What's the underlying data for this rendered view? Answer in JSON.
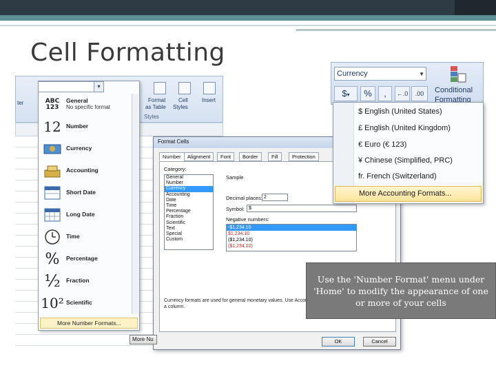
{
  "slide": {
    "title": "Cell Formatting",
    "callout": "Use the 'Number Format' menu under 'Home' to modify the appearance of one or more of your cells"
  },
  "ribbon": {
    "insert_label": "Insert",
    "format_as_table": "Format as Table",
    "cell_styles": "Cell Styles",
    "format_label": "Format",
    "cell_label": "Cell",
    "styles_group": "Styles",
    "ter_fragment": "ter",
    "as_table_fragment": "as Table",
    "styles_fragment": "Styles",
    "insert_fragment": "Insert"
  },
  "number_format_menu": {
    "items": [
      {
        "icon": "abc-123-icon",
        "glyph": "ABC 123",
        "label": "General",
        "sub": "No specific format"
      },
      {
        "icon": "number-12-icon",
        "glyph": "12",
        "label": "Number",
        "sub": ""
      },
      {
        "icon": "currency-icon",
        "glyph": "$",
        "label": "Currency",
        "sub": ""
      },
      {
        "icon": "accounting-icon",
        "glyph": "$",
        "label": "Accounting",
        "sub": ""
      },
      {
        "icon": "calendar-icon",
        "glyph": "",
        "label": "Short Date",
        "sub": ""
      },
      {
        "icon": "calendar-grid-icon",
        "glyph": "",
        "label": "Long Date",
        "sub": ""
      },
      {
        "icon": "clock-icon",
        "glyph": "",
        "label": "Time",
        "sub": ""
      },
      {
        "icon": "percent-icon",
        "glyph": "%",
        "label": "Percentage",
        "sub": ""
      },
      {
        "icon": "fraction-icon",
        "glyph": "½",
        "label": "Fraction",
        "sub": ""
      },
      {
        "icon": "scientific-icon",
        "glyph": "10²",
        "label": "Scientific",
        "sub": ""
      }
    ],
    "more_label": "More Number Formats..."
  },
  "format_cells": {
    "title": "Format Cells",
    "tabs": [
      "Number",
      "Alignment",
      "Font",
      "Border",
      "Fill",
      "Protection"
    ],
    "category_label": "Category:",
    "categories": [
      "General",
      "Number",
      "Currency",
      "Accounting",
      "Date",
      "Time",
      "Percentage",
      "Fraction",
      "Scientific",
      "Text",
      "Special",
      "Custom"
    ],
    "selected_category": "Currency",
    "sample_label": "Sample",
    "decimal_label": "Decimal places:",
    "decimal_value": "2",
    "symbol_label": "Symbol:",
    "symbol_value": "$",
    "negative_label": "Negative numbers:",
    "negative_numbers": [
      "-$1,234.10",
      "$1,234.10",
      "($1,234.10)",
      "($1,234.10)"
    ],
    "description": "Currency formats are used for general monetary values. Use Accounting formats to align decimal points in a column.",
    "ok_label": "OK",
    "cancel_label": "Cancel",
    "more_nu": "More Nu"
  },
  "currency_ribbon": {
    "combo_value": "Currency",
    "dollar_label": "$",
    "percent_label": "%",
    "comma_label": ",",
    "conditional_line1": "Conditional",
    "conditional_line2": "Formatting"
  },
  "accounting_menu": {
    "items": [
      "$ English (United States)",
      "£ English (United Kingdom)",
      "€ Euro (€ 123)",
      "¥ Chinese (Simplified, PRC)",
      "fr. French (Switzerland)"
    ],
    "more_label": "More Accounting Formats..."
  },
  "colors": {
    "top_bar": "#2f3b44",
    "accent_band": "#5e8f93",
    "callout_bg": "#7a7a7a",
    "selection_blue": "#3399ff",
    "hover_yellow": "#ffe39a"
  }
}
